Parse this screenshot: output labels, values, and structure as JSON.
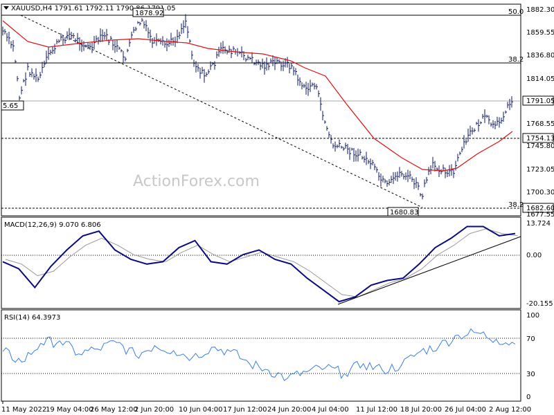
{
  "header": {
    "symbol_line": "XAUUSD,H4  1791.61 1792.11 1790.86 1791.05",
    "watermark": "ActionForex.com"
  },
  "price_panel": {
    "y_ticks": [
      "1882.30",
      "1859.55",
      "1836.80",
      "1814.05",
      "1791.05",
      "1768.55",
      "1745.80",
      "1723.05",
      "1700.30",
      "1677.55"
    ],
    "current_price_label": "1791.05",
    "fib_labels": [
      "50.0",
      "38.2",
      "38.2"
    ],
    "level_labels": [
      "1878.92",
      "1680.83",
      "1754.13",
      "1682.60",
      "5.65"
    ]
  },
  "macd_panel": {
    "title": "MACD(12,26,9) 9.070 6.806",
    "y_ticks": [
      "13.724",
      "0.00",
      "-20.155"
    ]
  },
  "rsi_panel": {
    "title": "RSI(14) 64.3973",
    "y_ticks": [
      "100",
      "70",
      "30",
      "0"
    ]
  },
  "x_labels": [
    "11 May 2022",
    "19 May 04:00",
    "26 May 12:00",
    "2 Jun 20:00",
    "10 Jun 04:00",
    "17 Jun 12:00",
    "24 Jun 20:00",
    "4 Jul 04:00",
    "11 Jul 12:00",
    "18 Jul 20:00",
    "26 Jul 04:00",
    "2 Aug 12:00"
  ],
  "colors": {
    "ma_line": "#e01010",
    "macd_line": "#0a0a80",
    "signal_line": "#999999",
    "rsi_line": "#3a7ee0",
    "bars": "#0b1560"
  },
  "chart_data": [
    {
      "type": "line",
      "title": "XAUUSD,H4",
      "ylim": [
        1672,
        1890
      ],
      "x": [
        0,
        10,
        20,
        30,
        40,
        50,
        60,
        70,
        80,
        90,
        100,
        110,
        120,
        130,
        140,
        150,
        160,
        170,
        180,
        190,
        200,
        212
      ],
      "series": [
        {
          "name": "close",
          "values": [
            1858,
            1848,
            1822,
            1828,
            1808,
            1848,
            1852,
            1862,
            1859,
            1850,
            1855,
            1866,
            1870,
            1862,
            1848,
            1852,
            1843,
            1838,
            1846,
            1840,
            1830,
            1825
          ]
        },
        {
          "name": "ma",
          "values": [
            1870,
            1855,
            1845,
            1843,
            1846,
            1850,
            1853,
            1855,
            1857,
            1858,
            1860,
            1862,
            1862,
            1860,
            1855,
            1852,
            1850,
            1848,
            1846,
            1845,
            1842,
            1840
          ]
        }
      ],
      "ref_lines": [
        1878.92,
        1827,
        1791.05,
        1754.13,
        1682.6
      ],
      "annotations": [
        "1878.92",
        "1680.83",
        "1754.13",
        "1682.60",
        "1791.05"
      ]
    },
    {
      "type": "line",
      "title": "MACD(12,26,9)",
      "ylim": [
        -20.155,
        13.724
      ],
      "series": [
        {
          "name": "MACD",
          "values": [
            -2,
            -5,
            -13,
            -4,
            3,
            9,
            11,
            3,
            -1,
            -3,
            -2,
            4,
            7,
            -2,
            -3,
            1,
            3,
            -1,
            -3,
            -9,
            -14,
            -19,
            -17,
            -12,
            -10,
            -9,
            -3,
            4,
            8,
            13,
            13,
            9,
            10
          ]
        },
        {
          "name": "signal",
          "values": [
            -1,
            -3,
            -8,
            -6,
            0,
            5,
            8,
            5,
            1,
            -1,
            -2,
            2,
            5,
            1,
            -2,
            0,
            2,
            0,
            -2,
            -6,
            -11,
            -16,
            -17,
            -14,
            -11,
            -9,
            -5,
            1,
            5,
            10,
            12,
            10,
            9
          ]
        }
      ]
    },
    {
      "type": "line",
      "title": "RSI(14)",
      "ylim": [
        0,
        100
      ],
      "series": [
        {
          "name": "RSI",
          "values": [
            55,
            42,
            65,
            68,
            52,
            58,
            66,
            50,
            62,
            56,
            48,
            60,
            55,
            40,
            32,
            22,
            30,
            35,
            28,
            40,
            32,
            38,
            55,
            62,
            75,
            78,
            70,
            64
          ]
        }
      ]
    }
  ]
}
